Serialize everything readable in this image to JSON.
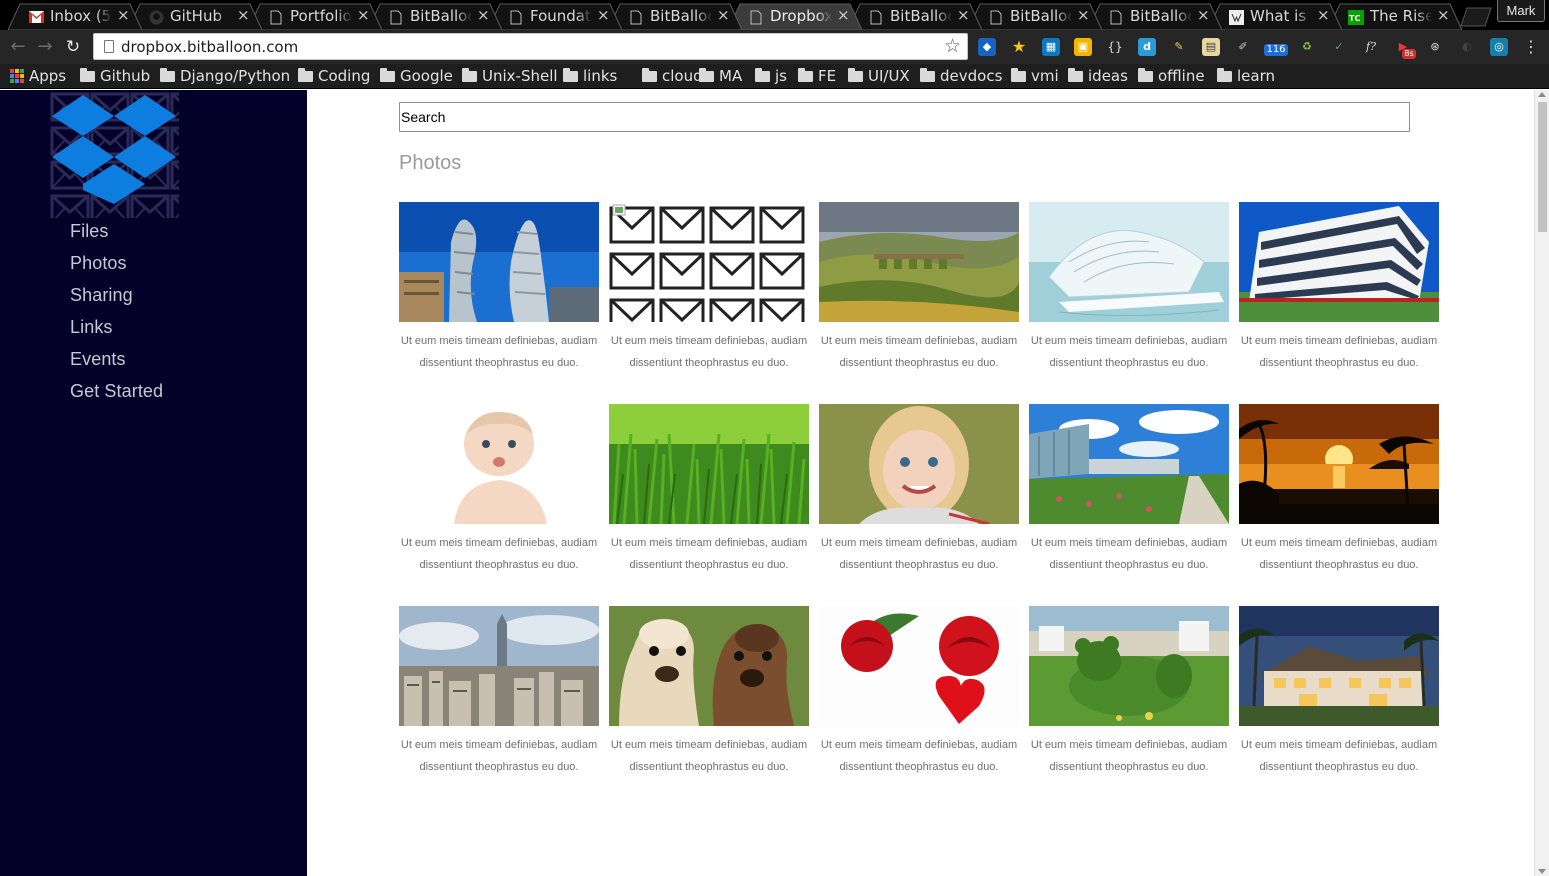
{
  "browser": {
    "tabs": [
      {
        "title": "Inbox (5",
        "icon": "gmail-icon",
        "active": false
      },
      {
        "title": "GitHub",
        "icon": "github-icon",
        "active": false
      },
      {
        "title": "Portfolio",
        "icon": "page-icon",
        "active": false
      },
      {
        "title": "BitBalloo",
        "icon": "page-icon",
        "active": false
      },
      {
        "title": "Foundati",
        "icon": "page-icon",
        "active": false
      },
      {
        "title": "BitBalloo",
        "icon": "page-icon",
        "active": false
      },
      {
        "title": "Dropbox",
        "icon": "page-icon",
        "active": true
      },
      {
        "title": "BitBalloo",
        "icon": "page-icon",
        "active": false
      },
      {
        "title": "BitBalloo",
        "icon": "page-icon",
        "active": false
      },
      {
        "title": "BitBalloo",
        "icon": "page-icon",
        "active": false
      },
      {
        "title": "What is a",
        "icon": "wiki-icon",
        "active": false
      },
      {
        "title": "The Rise",
        "icon": "techcrunch-icon",
        "active": false
      }
    ],
    "close_glyph": "×",
    "profile_name": "Mark",
    "url": "dropbox.bitballoon.com",
    "extension_badge_count": "116",
    "extension_badge_count_2": "8s",
    "bookmarks": [
      {
        "label": "Apps",
        "icon": "apps-grid-icon"
      },
      {
        "label": "Github",
        "icon": "folder-icon"
      },
      {
        "label": "Django/Python",
        "icon": "folder-icon"
      },
      {
        "label": "Coding",
        "icon": "folder-icon"
      },
      {
        "label": "Google",
        "icon": "folder-icon"
      },
      {
        "label": "Unix-Shell",
        "icon": "folder-icon"
      },
      {
        "label": "links",
        "icon": "folder-icon"
      },
      {
        "label": "cloud",
        "icon": "folder-icon"
      },
      {
        "label": "MA",
        "icon": "folder-icon"
      },
      {
        "label": "js",
        "icon": "folder-icon"
      },
      {
        "label": "FE",
        "icon": "folder-icon"
      },
      {
        "label": "UI/UX",
        "icon": "folder-icon"
      },
      {
        "label": "devdocs",
        "icon": "folder-icon"
      },
      {
        "label": "vmi",
        "icon": "folder-icon"
      },
      {
        "label": "ideas",
        "icon": "folder-icon"
      },
      {
        "label": "offline",
        "icon": "folder-icon"
      },
      {
        "label": "learn",
        "icon": "folder-icon"
      }
    ]
  },
  "sidebar": {
    "logo": "dropbox-logo",
    "nav": [
      "Files",
      "Photos",
      "Sharing",
      "Links",
      "Events",
      "Get Started"
    ]
  },
  "main": {
    "search_placeholder": "Search",
    "section_title": "Photos",
    "photos": [
      {
        "subject": "twin towers against blue sky",
        "caption_line1": "Ut eum meis timeam definiebas, audiam",
        "caption_line2": "dissentiunt theophrastus eu duo."
      },
      {
        "subject": "envelope pattern (broken image)",
        "caption_line1": "Ut eum meis timeam definiebas, audiam",
        "caption_line2": "dissentiunt theophrastus eu duo."
      },
      {
        "subject": "green hills with viaduct",
        "caption_line1": "Ut eum meis timeam definiebas, audiam",
        "caption_line2": "dissentiunt theophrastus eu duo."
      },
      {
        "subject": "white futuristic pavilion on water",
        "caption_line1": "Ut eum meis timeam definiebas, audiam",
        "caption_line2": "dissentiunt theophrastus eu duo."
      },
      {
        "subject": "modern office building",
        "caption_line1": "Ut eum meis timeam definiebas, audiam",
        "caption_line2": "dissentiunt theophrastus eu duo."
      },
      {
        "subject": "baby blowing a kiss",
        "caption_line1": "Ut eum meis timeam definiebas, audiam",
        "caption_line2": "dissentiunt theophrastus eu duo."
      },
      {
        "subject": "green grass close-up",
        "caption_line1": "Ut eum meis timeam definiebas, audiam",
        "caption_line2": "dissentiunt theophrastus eu duo."
      },
      {
        "subject": "smiling blonde girl",
        "caption_line1": "Ut eum meis timeam definiebas, audiam",
        "caption_line2": "dissentiunt theophrastus eu duo."
      },
      {
        "subject": "glass building with garden",
        "caption_line1": "Ut eum meis timeam definiebas, audiam",
        "caption_line2": "dissentiunt theophrastus eu duo."
      },
      {
        "subject": "tropical sunset with palms",
        "caption_line1": "Ut eum meis timeam definiebas, audiam",
        "caption_line2": "dissentiunt theophrastus eu duo."
      },
      {
        "subject": "city skyline",
        "caption_line1": "Ut eum meis timeam definiebas, audiam",
        "caption_line2": "dissentiunt theophrastus eu duo."
      },
      {
        "subject": "two alpacas",
        "caption_line1": "Ut eum meis timeam definiebas, audiam",
        "caption_line2": "dissentiunt theophrastus eu duo."
      },
      {
        "subject": "red roses and heart",
        "caption_line1": "Ut eum meis timeam definiebas, audiam",
        "caption_line2": "dissentiunt theophrastus eu duo."
      },
      {
        "subject": "topiary bear in garden",
        "caption_line1": "Ut eum meis timeam definiebas, audiam",
        "caption_line2": "dissentiunt theophrastus eu duo."
      },
      {
        "subject": "luxury house at dusk",
        "caption_line1": "Ut eum meis timeam definiebas, audiam",
        "caption_line2": "dissentiunt theophrastus eu duo."
      }
    ]
  },
  "colors": {
    "sidebar_bg": "#03012a",
    "sidebar_text": "#c9c9d3",
    "dropbox_blue": "#0d7ee0",
    "caption_text": "#6f6f6f",
    "section_title": "#9a9a9a"
  }
}
